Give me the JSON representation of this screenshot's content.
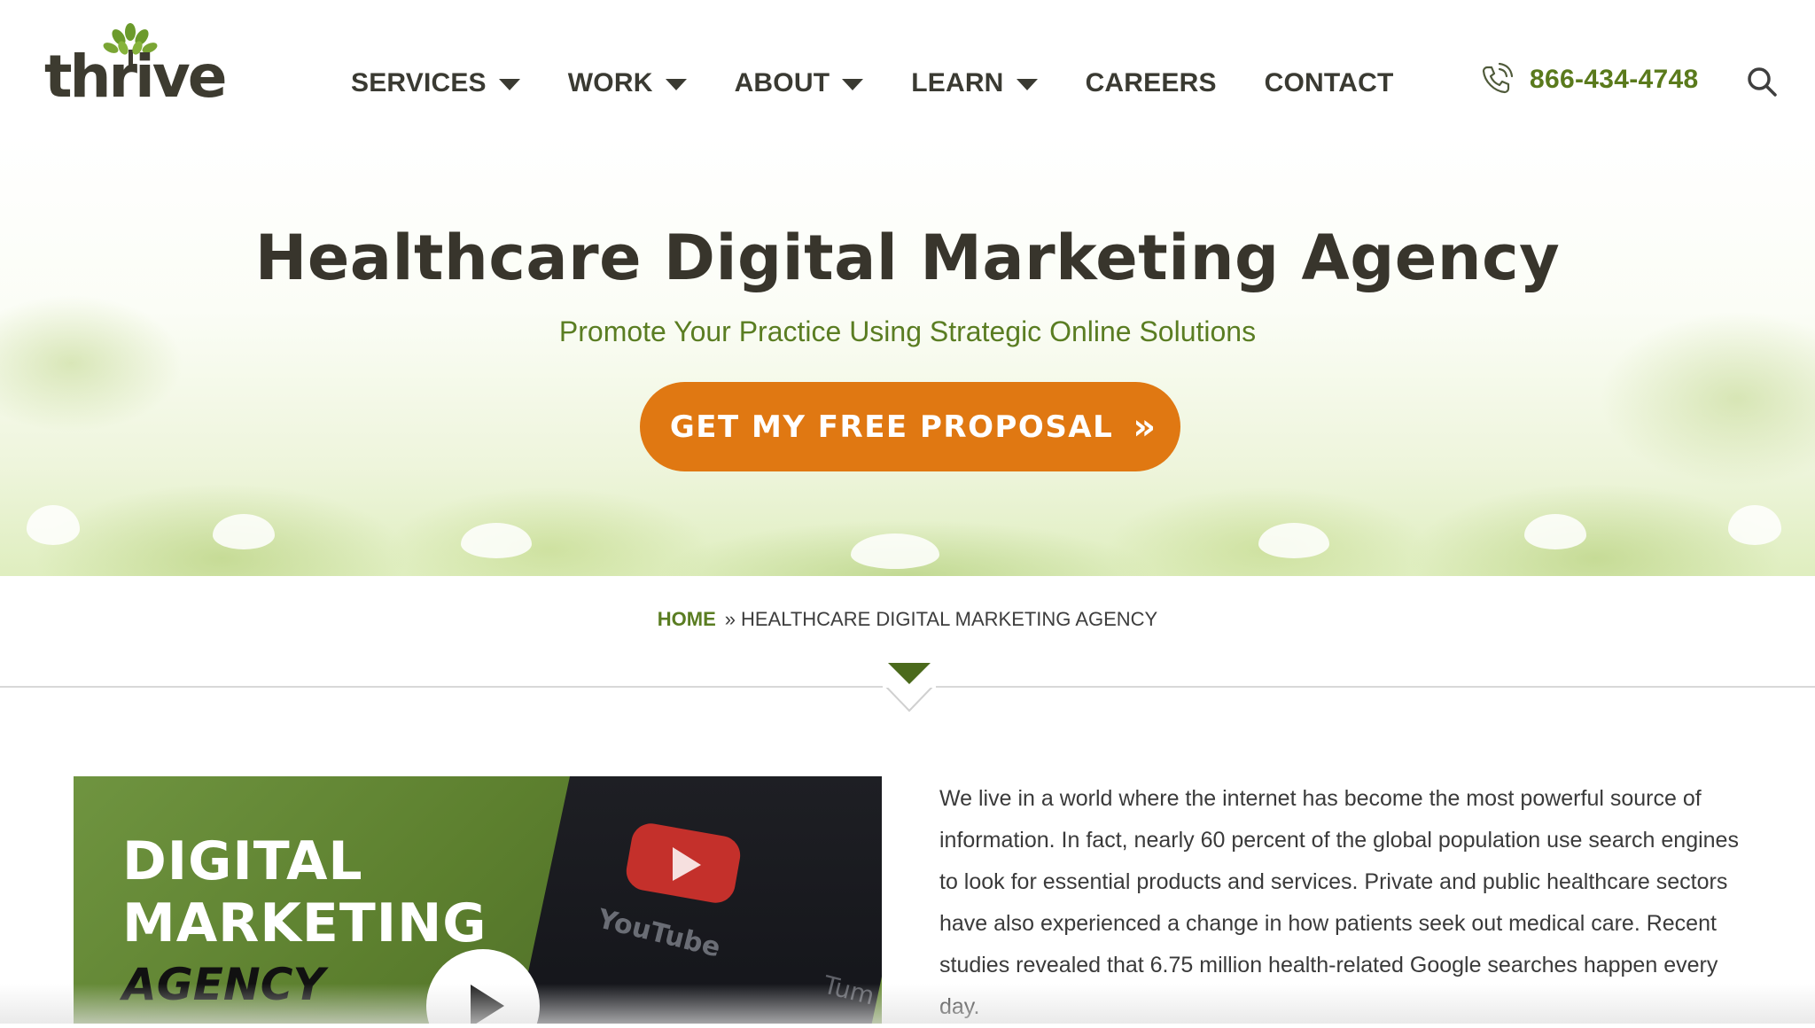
{
  "header": {
    "logo_text": "thrive",
    "nav": [
      {
        "label": "SERVICES"
      },
      {
        "label": "WORK"
      },
      {
        "label": "ABOUT"
      },
      {
        "label": "LEARN"
      },
      {
        "label": "CAREERS"
      },
      {
        "label": "CONTACT"
      }
    ],
    "phone": "866-434-4748"
  },
  "hero": {
    "title": "Healthcare Digital Marketing Agency",
    "subtitle": "Promote Your Practice Using Strategic Online Solutions",
    "cta_label": "GET MY FREE PROPOSAL",
    "cta_arrow": "»"
  },
  "breadcrumb": {
    "home": "HOME",
    "separator": "»",
    "current": "HEALTHCARE DIGITAL MARKETING AGENCY"
  },
  "video": {
    "line1": "DIGITAL",
    "line2": "MARKETING",
    "line3": "AGENCY",
    "youtube_text": "YouTube",
    "tumblr_text": "Tum"
  },
  "content": {
    "paragraph": "We live in a world where the internet has become the most powerful source of information. In fact, nearly 60 percent of the global population use search engines to look for essential products and services. Private and public healthcare sectors have also experienced a change in how patients seek out medical care. Recent studies revealed that 6.75 million health-related Google searches happen every day."
  },
  "colors": {
    "brand_green": "#5a7d22",
    "cta_orange": "#e07812",
    "dark_text": "#38352c"
  },
  "icons": [
    "tree-logo-icon",
    "caret-down-icon",
    "phone-icon",
    "search-icon",
    "double-chevron-right-icon",
    "play-icon",
    "youtube-icon"
  ]
}
